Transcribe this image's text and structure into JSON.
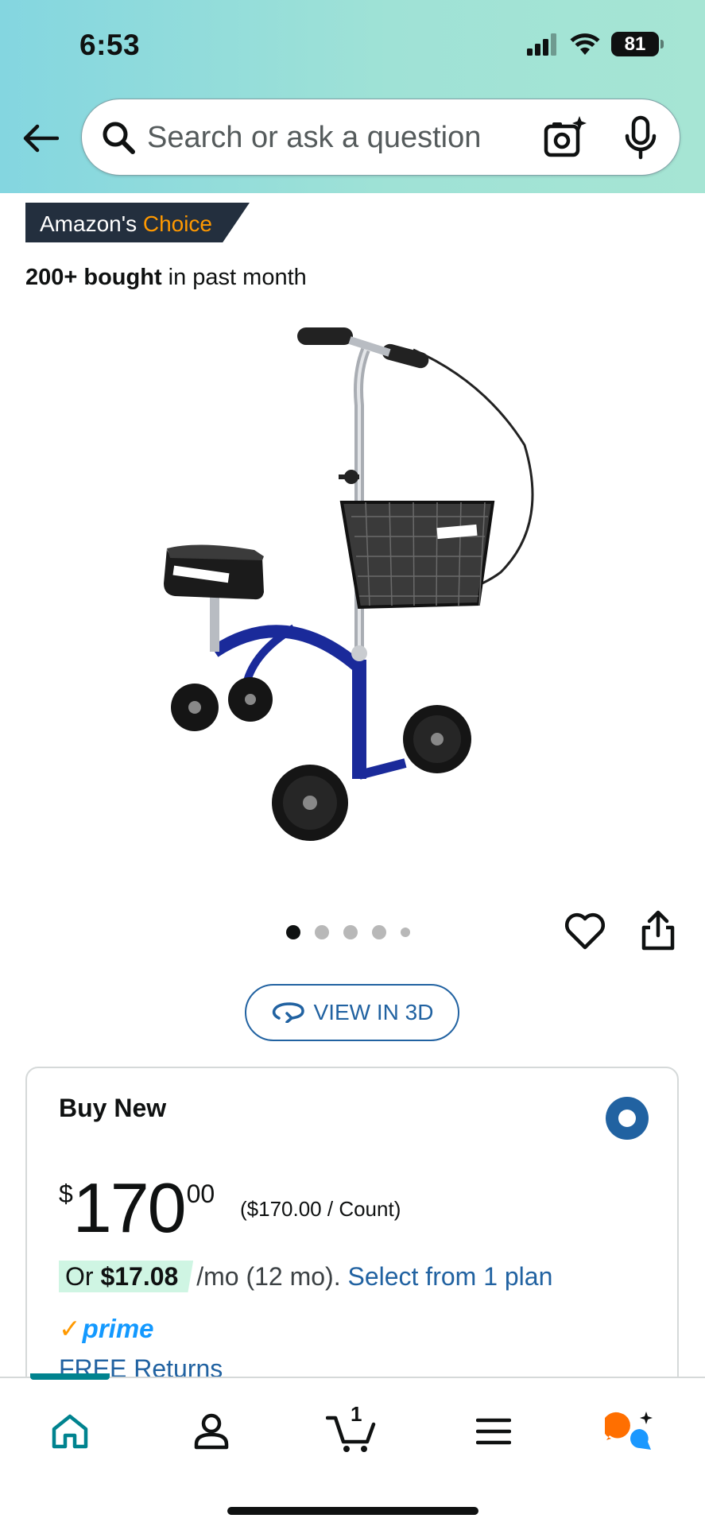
{
  "status_bar": {
    "time": "6:53",
    "battery": "81"
  },
  "search": {
    "placeholder": "Search or ask a question"
  },
  "product": {
    "badge_prefix": "Amazon's",
    "badge_accent": "Choice",
    "bought_count": "200+ bought",
    "bought_suffix": "in past month",
    "image_icon": "knee-scooter-image"
  },
  "gallery": {
    "image_count": 5,
    "active_index": 0
  },
  "view_3d_label": "VIEW IN 3D",
  "buy_box": {
    "title": "Buy New",
    "price_symbol": "$",
    "price_whole": "170",
    "price_fraction": "00",
    "unit_price": "($170.00 / Count)",
    "installment_or": "Or",
    "installment_amount": "$17.08",
    "installment_term": "/mo (12 mo).",
    "installment_link": "Select from 1 plan",
    "prime_check": "✓",
    "prime_label": "prime",
    "free_returns": "FREE Returns"
  },
  "bottom_nav": {
    "items": [
      "home-icon",
      "account-icon",
      "cart-icon",
      "menu-icon",
      "rufus-icon"
    ],
    "cart_count": "1",
    "active": "home"
  },
  "colors": {
    "header_gradient_start": "#84d6e0",
    "header_gradient_end": "#a6e5d4",
    "link_blue": "#2162a1",
    "badge_navy": "#232f3e",
    "amazon_orange": "#ff9900",
    "prime_blue": "#1399ff",
    "nav_teal": "#00838f"
  }
}
